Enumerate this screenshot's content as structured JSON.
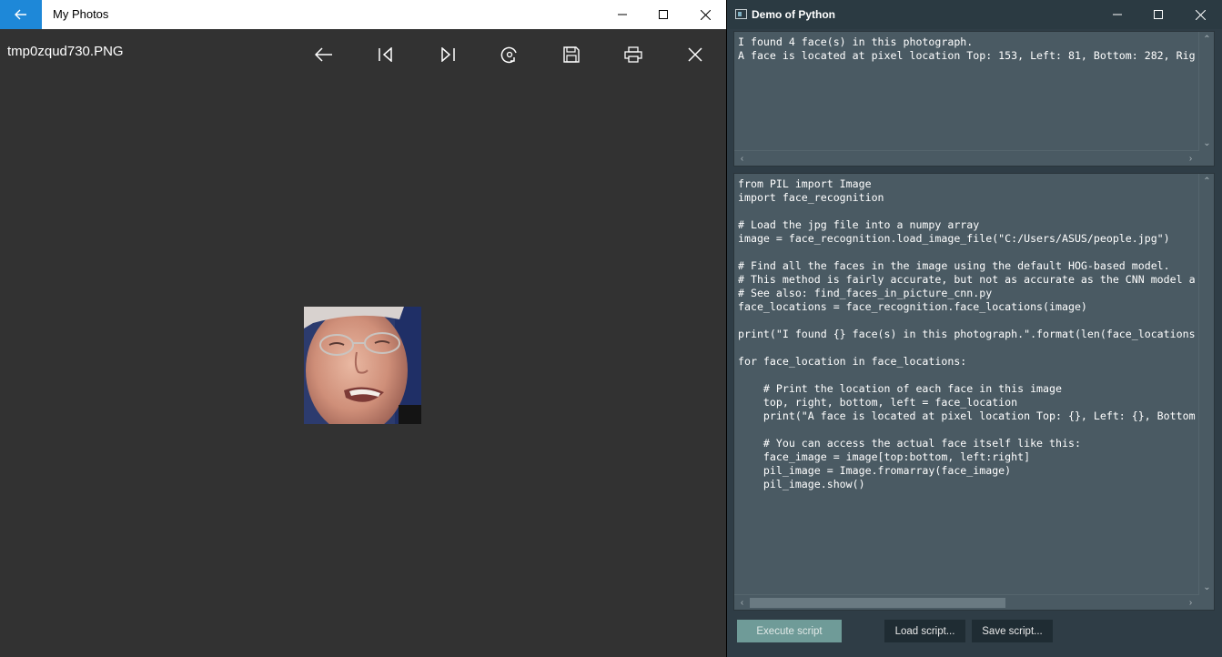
{
  "photos": {
    "window_title": "My Photos",
    "filename": "tmp0zqud730.PNG",
    "toolbar_icons": [
      "arrow-left-icon",
      "previous-icon",
      "next-icon",
      "rotate-icon",
      "save-icon",
      "print-icon",
      "close-icon"
    ]
  },
  "python_window": {
    "title": "Demo of Python",
    "output": {
      "lines": [
        "I found 4 face(s) in this photograph.",
        "A face is located at pixel location Top: 153, Left: 81, Bottom: 282, Rig"
      ]
    },
    "script": {
      "lines": [
        "from PIL import Image",
        "import face_recognition",
        "",
        "# Load the jpg file into a numpy array",
        "image = face_recognition.load_image_file(\"C:/Users/ASUS/people.jpg\")",
        "",
        "# Find all the faces in the image using the default HOG-based model.",
        "# This method is fairly accurate, but not as accurate as the CNN model a",
        "# See also: find_faces_in_picture_cnn.py",
        "face_locations = face_recognition.face_locations(image)",
        "",
        "print(\"I found {} face(s) in this photograph.\".format(len(face_locations",
        "",
        "for face_location in face_locations:",
        "",
        "    # Print the location of each face in this image",
        "    top, right, bottom, left = face_location",
        "    print(\"A face is located at pixel location Top: {}, Left: {}, Bottom",
        "",
        "    # You can access the actual face itself like this:",
        "    face_image = image[top:bottom, left:right]",
        "    pil_image = Image.fromarray(face_image)",
        "    pil_image.show()"
      ]
    },
    "buttons": {
      "execute": "Execute script",
      "load": "Load script...",
      "save": "Save script..."
    }
  },
  "colors": {
    "accent_blue": "#1e88d8",
    "photos_bg": "#323232",
    "panel_bg": "#4a5a63",
    "execute_bg": "#6f9b98"
  }
}
